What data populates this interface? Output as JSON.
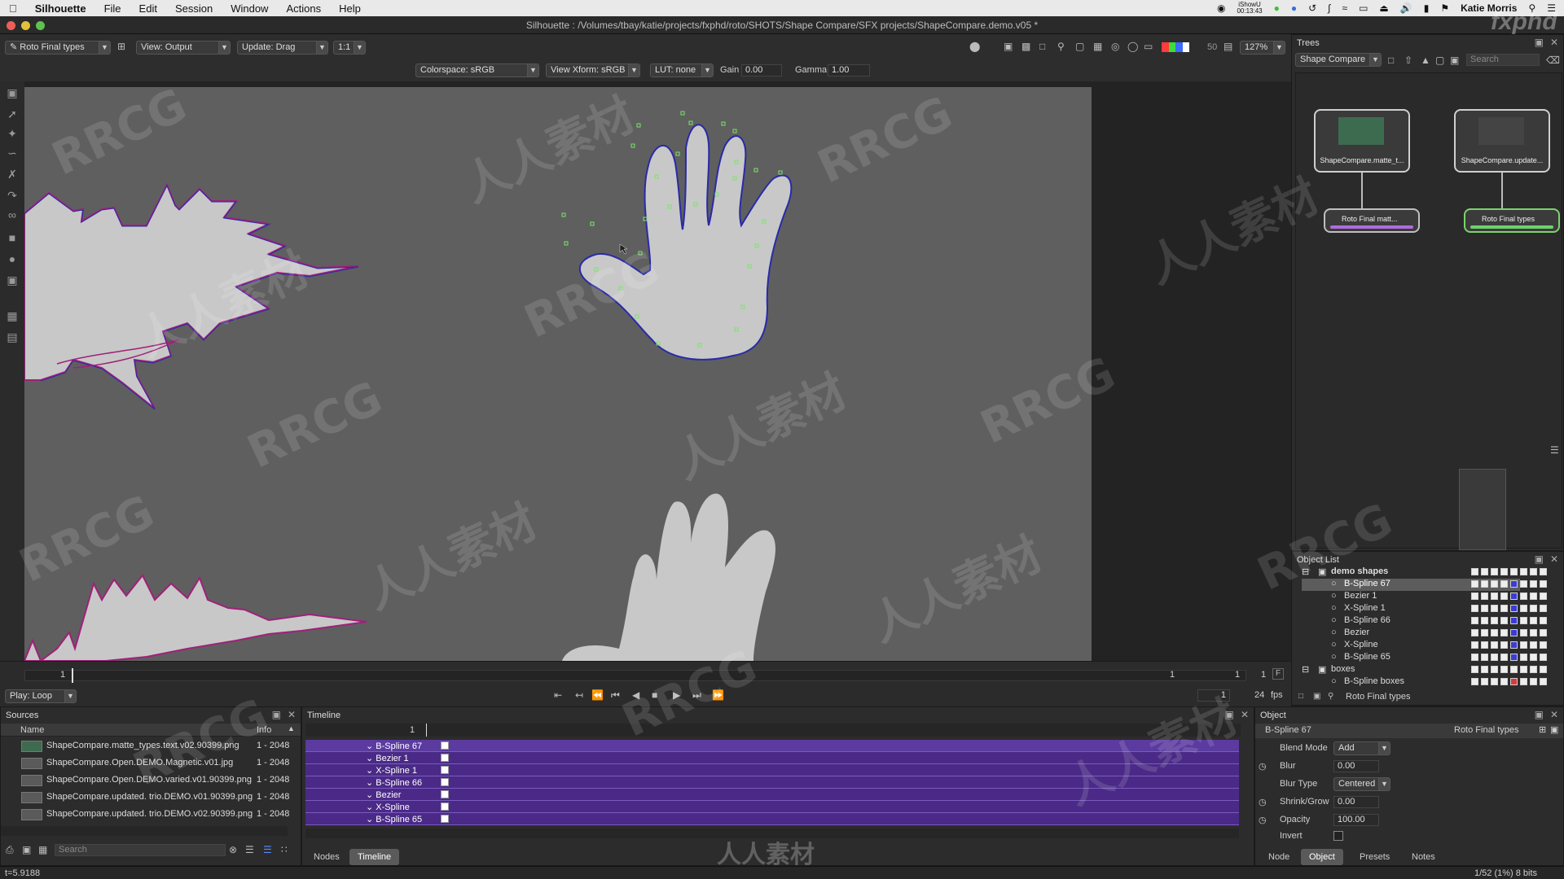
{
  "menubar": {
    "app": "Silhouette",
    "items": [
      "File",
      "Edit",
      "Session",
      "Window",
      "Actions",
      "Help"
    ],
    "ishowu": "iShowU",
    "ishowu_time": "00:13:43",
    "user": "Katie Morris"
  },
  "window": {
    "title": "Silhouette : /Volumes/tbay/katie/projects/fxphd/roto/SHOTS/Shape Compare/SFX projects/ShapeCompare.demo.v05 *"
  },
  "toolbar": {
    "session_select": "Roto Final types",
    "view_select": "View: Output",
    "update_select": "Update: Drag",
    "ratio_select": "1:1",
    "colorspace": "Colorspace: sRGB",
    "view_xform": "View Xform: sRGB",
    "lut": "LUT: none",
    "gain_label": "Gain",
    "gain_value": "0.00",
    "gamma_label": "Gamma",
    "gamma_value": "1.00",
    "frame_value": "50",
    "zoom": "127%"
  },
  "transport": {
    "frame_current": "1",
    "frame_right_a": "1",
    "frame_right_b": "1",
    "frame_right_c": "1",
    "f_button": "F",
    "play_mode": "Play: Loop",
    "start_frame": "1",
    "fps_value": "24",
    "fps_label": "fps"
  },
  "trees": {
    "title": "Trees",
    "tree_select": "Shape Compare",
    "search_placeholder": "Search",
    "nodes": [
      {
        "caption": "ShapeCompare.matte_t..."
      },
      {
        "caption": "ShapeCompare.update..."
      }
    ],
    "roto_nodes": [
      {
        "caption": "Roto Final matt...",
        "bar_color": "#b06be0"
      },
      {
        "caption": "Roto Final types",
        "bar_color": "#6bd36b"
      }
    ]
  },
  "object_list": {
    "title": "Object List",
    "groups": [
      {
        "name": "demo shapes",
        "items": [
          "B-Spline 67",
          "Bezier 1",
          "X-Spline 1",
          "B-Spline 66",
          "Bezier",
          "X-Spline",
          "B-Spline 65"
        ]
      },
      {
        "name": "boxes",
        "items": [
          "B-Spline boxes"
        ]
      }
    ],
    "selected": "B-Spline 67",
    "footer_layer": "Roto Final types"
  },
  "sources": {
    "title": "Sources",
    "col_name": "Name",
    "col_info": "Info",
    "rows": [
      {
        "name": "ShapeCompare.matte_types.text.v02.90399.png",
        "info": "1 - 2048"
      },
      {
        "name": "ShapeCompare.Open.DEMO.Magnetic.v01.jpg",
        "info": "1 - 2048"
      },
      {
        "name": "ShapeCompare.Open.DEMO.varied.v01.90399.png",
        "info": "1 - 2048"
      },
      {
        "name": "ShapeCompare.updated. trio.DEMO.v01.90399.png",
        "info": "1 - 2048"
      },
      {
        "name": "ShapeCompare.updated. trio.DEMO.v02.90399.png",
        "info": "1 - 2048"
      }
    ],
    "search_placeholder": "Search"
  },
  "timeline": {
    "title": "Timeline",
    "frame_marker": "1",
    "tracks": [
      "B-Spline 67",
      "Bezier 1",
      "X-Spline 1",
      "B-Spline 66",
      "Bezier",
      "X-Spline",
      "B-Spline 65"
    ],
    "tabs": [
      "Nodes",
      "Timeline"
    ],
    "active_tab": "Timeline"
  },
  "object_panel": {
    "title": "Object",
    "object_name": "B-Spline 67",
    "layer_name": "Roto Final types",
    "blend_mode_label": "Blend Mode",
    "blend_mode_value": "Add",
    "blur_label": "Blur",
    "blur_value": "0.00",
    "blur_type_label": "Blur Type",
    "blur_type_value": "Centered",
    "shrink_label": "Shrink/Grow",
    "shrink_value": "0.00",
    "opacity_label": "Opacity",
    "opacity_value": "100.00",
    "invert_label": "Invert",
    "tabs": [
      "Node",
      "Object",
      "Presets",
      "Notes"
    ],
    "active_tab": "Object"
  },
  "status": {
    "time": "t=5.9188",
    "memory": "1/52 (1%) 8 bits"
  },
  "watermark": {
    "latin": "RRCG",
    "cjk": "人人素材",
    "corner": "fxphd"
  },
  "colors": {
    "spline_blue": "#2a2aa8",
    "spline_magenta": "#a0207a",
    "point_green": "#7be36b",
    "track_purple": "#4a2a86",
    "shape_fill": "#c8c8c8"
  }
}
